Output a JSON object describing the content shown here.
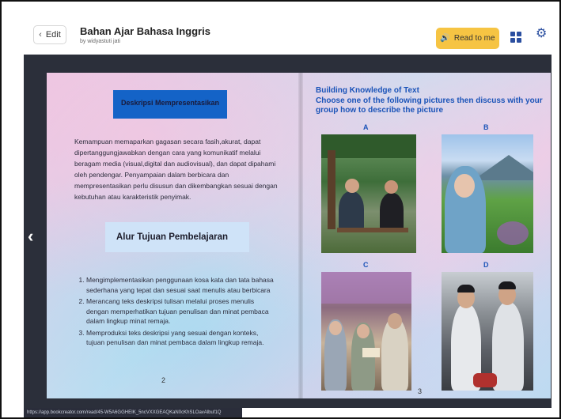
{
  "header": {
    "edit_label": "Edit",
    "title": "Bahan Ajar Bahasa Inggris",
    "byline": "by widyastuti jati",
    "read_label": "Read to me",
    "icons": {
      "back": "chevron-left-icon",
      "speaker": "speaker-icon",
      "grid": "grid-icon",
      "settings": "gear-icon"
    },
    "accent_color": "#f6c443",
    "icon_color": "#2b4fa0"
  },
  "left_page": {
    "desc_heading": "Deskripsi Mempresentasikan",
    "desc_text": "Kemampuan memaparkan gagasan secara fasih,akurat, dapat dipertanggungjawabkan dengan cara yang komunikatif melalui beragam media (visual,digital dan audiovisual), dan dapat dipahami oleh pendengar. Penyampaian dalam berbicara dan mempresentasikan perlu disusun dan dikembangkan sesuai dengan kebutuhan atau karakteristik penyimak.",
    "alur_heading": "Alur Tujuan Pembelajaran",
    "goals": [
      "Mengimplementasikan penggunaan kosa kata dan tata bahasa  sederhana yang tepat dan sesuai saat  menulis atau berbicara",
      "Merancang teks deskripsi tulisan melalui proses menulis dengan memperhatikan tujuan penulisan dan minat pembaca dalam lingkup minat remaja.",
      "Memproduksi teks deskripsi yang sesuai dengan konteks, tujuan penulisan dan minat pembaca dalam lingkup remaja."
    ],
    "page_number": "2"
  },
  "right_page": {
    "heading_line1": "Building Knowledge of Text",
    "heading_line2": "Choose one of the following pictures then discuss with your group how to describe the picture",
    "pictures": [
      {
        "label": "A"
      },
      {
        "label": "B"
      },
      {
        "label": "C"
      },
      {
        "label": "D"
      }
    ],
    "page_number": "3"
  },
  "navigation": {
    "prev_icon": "chevron-left-icon"
  },
  "status_url": "https://app.bookcreator.com/read/45-W5A6GGHEIK_5ncVXXGEAQKaN0cKhSLOavAlbuf1Q"
}
